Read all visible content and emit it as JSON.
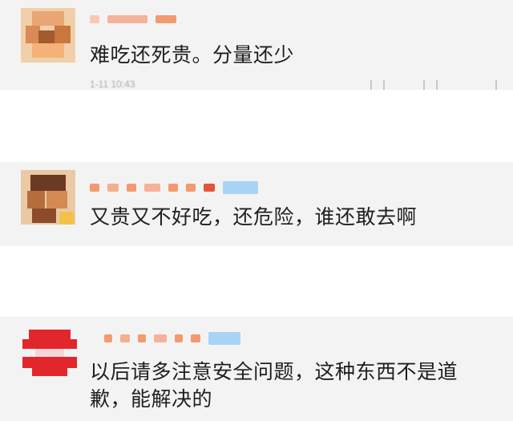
{
  "comments": [
    {
      "text": "难吃还死贵。分量还少",
      "timestamp": "1-11 10:43"
    },
    {
      "text": "又贵又不好吃，还危险，谁还敢去啊"
    },
    {
      "text": "以后请多注意安全问题，这种东西不是道歉，能解决的"
    }
  ],
  "icons": [
    "share-icon",
    "comment-icon",
    "like-icon"
  ]
}
